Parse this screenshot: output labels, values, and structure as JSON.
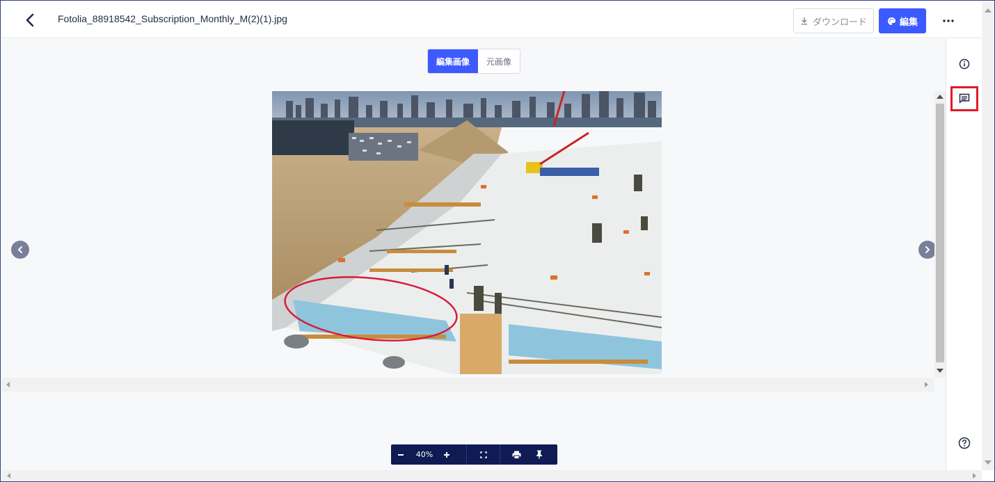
{
  "header": {
    "filename": "Fotolia_88918542_Subscription_Monthly_M(2)(1).jpg",
    "download_label": "ダウンロード",
    "edit_label": "編集"
  },
  "viewer": {
    "tabs": [
      "編集画像",
      "元画像"
    ],
    "active_tab": "編集画像",
    "zoom_level": "40%"
  },
  "icons": {
    "back": "chevron-left-icon",
    "download": "download-icon",
    "edit": "palette-icon",
    "more": "more-horizontal-icon",
    "info": "info-icon",
    "comment": "comment-icon",
    "help": "help-icon",
    "prev": "chevron-left-icon",
    "next": "chevron-right-icon",
    "zoom_out": "minus-icon",
    "zoom_in": "plus-icon",
    "fit": "fit-screen-icon",
    "print": "print-icon",
    "pin": "pin-icon"
  },
  "colors": {
    "accent": "#3d5afe",
    "toolbar": "#0f1b52",
    "highlight": "#e01b24",
    "annotation": "#d81b3b"
  }
}
